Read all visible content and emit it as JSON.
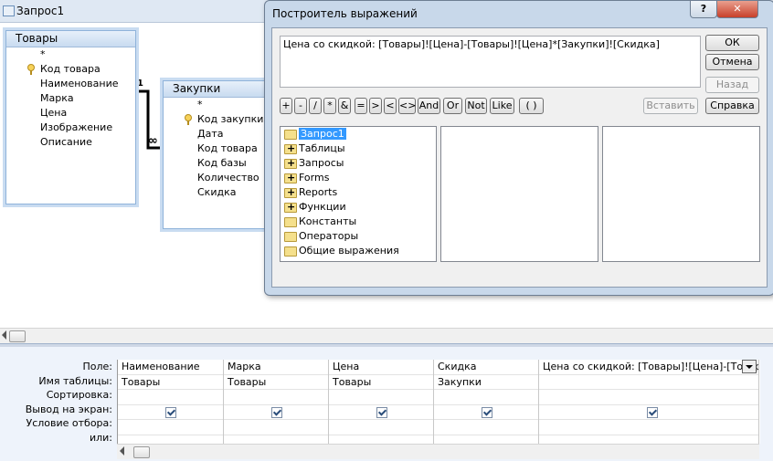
{
  "window": {
    "title": "Запрос1"
  },
  "tables": [
    {
      "name": "Товары",
      "fields": [
        "*",
        "Код товара",
        "Наименование",
        "Марка",
        "Цена",
        "Изображение",
        "Описание"
      ],
      "key_index": 1
    },
    {
      "name": "Закупки",
      "fields": [
        "*",
        "Код закупки",
        "Дата",
        "Код товара",
        "Код базы",
        "Количество",
        "Скидка"
      ],
      "key_index": 1
    }
  ],
  "relationship": {
    "one_label": "1",
    "many_label": "∞"
  },
  "dialog": {
    "title": "Построитель выражений",
    "help_caption": "?",
    "close_caption": "✕",
    "expression": "Цена со скидкой: [Товары]![Цена]-[Товары]![Цена]*[Закупки]![Скидка]",
    "buttons": {
      "ok": "ОК",
      "cancel": "Отмена",
      "back": "Назад",
      "help": "Справка",
      "paste": "Вставить"
    },
    "operators": [
      "+",
      "-",
      "/",
      "*",
      "&",
      "=",
      ">",
      "<",
      "<>",
      "And",
      "Or",
      "Not",
      "Like",
      "( )"
    ],
    "tree": [
      {
        "label": "Запрос1",
        "expand": "none",
        "selected": true
      },
      {
        "label": "Таблицы",
        "expand": "plus"
      },
      {
        "label": "Запросы",
        "expand": "plus"
      },
      {
        "label": "Forms",
        "expand": "plus"
      },
      {
        "label": "Reports",
        "expand": "plus"
      },
      {
        "label": "Функции",
        "expand": "plus"
      },
      {
        "label": "Константы",
        "expand": "none"
      },
      {
        "label": "Операторы",
        "expand": "none"
      },
      {
        "label": "Общие выражения",
        "expand": "none"
      }
    ]
  },
  "grid": {
    "row_labels": [
      "Поле:",
      "Имя таблицы:",
      "Сортировка:",
      "Вывод на экран:",
      "Условие отбора:",
      "или:"
    ],
    "columns": [
      {
        "field": "Наименование",
        "table": "Товары",
        "show": true
      },
      {
        "field": "Марка",
        "table": "Товары",
        "show": true
      },
      {
        "field": "Цена",
        "table": "Товары",
        "show": true
      },
      {
        "field": "Скидка",
        "table": "Закупки",
        "show": true
      },
      {
        "field": "Цена со скидкой: [Товары]![Цена]-[Товары]![Цена]*[Закупки]![Скидка]",
        "table": "",
        "show": true
      }
    ]
  }
}
